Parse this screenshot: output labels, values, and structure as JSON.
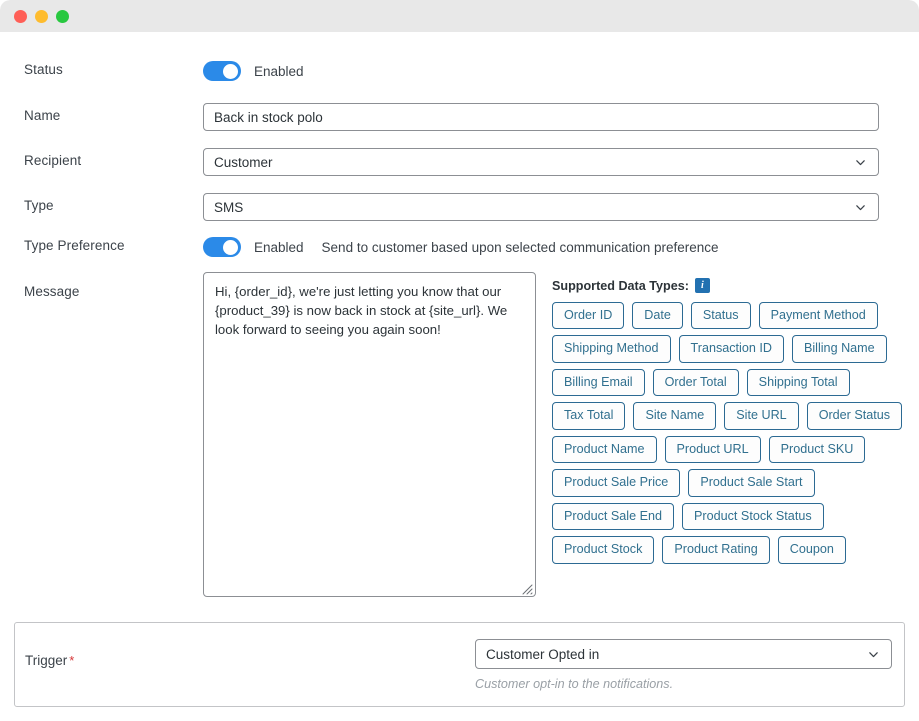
{
  "window": {
    "traffic_lights": [
      "close",
      "minimize",
      "maximize"
    ]
  },
  "form": {
    "rows": {
      "status": {
        "label": "Status",
        "toggle_state": "on",
        "toggle_label": "Enabled"
      },
      "name": {
        "label": "Name",
        "value": "Back in stock polo"
      },
      "recipient": {
        "label": "Recipient",
        "value": "Customer"
      },
      "type": {
        "label": "Type",
        "value": "SMS"
      },
      "type_preference": {
        "label": "Type Preference",
        "toggle_state": "on",
        "toggle_label": "Enabled",
        "hint": "Send to customer based upon selected communication preference"
      },
      "message": {
        "label": "Message",
        "value": "Hi, {order_id}, we're just letting you know that our {product_39} is now back in stock at {site_url}. We look forward to seeing you again soon!"
      }
    }
  },
  "data_types": {
    "heading": "Supported Data Types:",
    "info_icon": "info-icon",
    "info_glyph": "i",
    "rows": [
      [
        "Order ID",
        "Date",
        "Status",
        "Payment Method"
      ],
      [
        "Shipping Method",
        "Transaction ID",
        "Billing Name"
      ],
      [
        "Billing Email",
        "Order Total",
        "Shipping Total"
      ],
      [
        "Tax Total",
        "Site Name",
        "Site URL",
        "Order Status"
      ],
      [
        "Product Name",
        "Product URL",
        "Product SKU"
      ],
      [
        "Product Sale Price",
        "Product Sale Start"
      ],
      [
        "Product Sale End",
        "Product Stock Status"
      ],
      [
        "Product Stock",
        "Product Rating",
        "Coupon"
      ]
    ]
  },
  "trigger": {
    "label": "Trigger",
    "required_mark": "*",
    "value": "Customer Opted in",
    "help": "Customer opt-in to the notifications."
  },
  "colors": {
    "toggle_on": "#2b8ae8",
    "chip_border": "#2c6a93",
    "chip_text": "#31708f",
    "info_badge": "#2271b1",
    "required": "#d63638",
    "label_text": "#3c434a",
    "titlebar": "#e8e8e8"
  }
}
